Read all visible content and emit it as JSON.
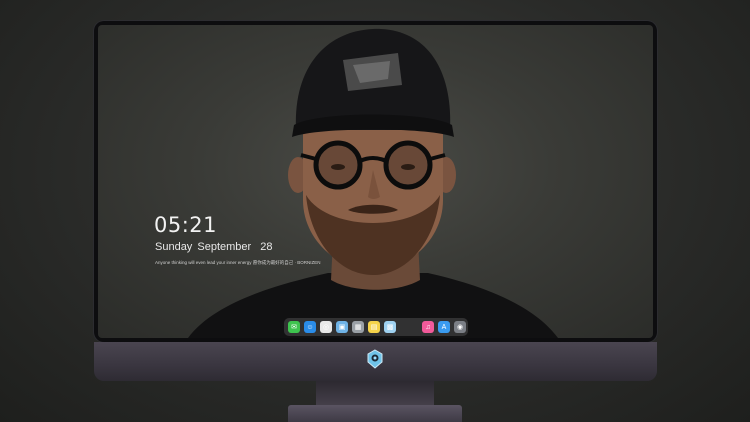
{
  "lockscreen": {
    "time": "05:21",
    "date_weekday": "Sunday",
    "date_month": "September",
    "date_day": "28",
    "quote": "Anyone thinking will even lead your inner energy 愿你成为最好的自己 · BORNIZEN"
  },
  "dock": {
    "apps": [
      {
        "name": "messages-icon",
        "color": "#3ec44f",
        "glyph": "✉"
      },
      {
        "name": "finder-icon",
        "color": "#2a8ce8",
        "glyph": "☺"
      },
      {
        "name": "safari-icon",
        "color": "#e8e8e8",
        "glyph": "◎"
      },
      {
        "name": "preview-icon",
        "color": "#6fb3e6",
        "glyph": "▣"
      },
      {
        "name": "clapper-icon",
        "color": "#9aa0a6",
        "glyph": "▦"
      },
      {
        "name": "notes-icon",
        "color": "#f5d34a",
        "glyph": "▤"
      },
      {
        "name": "photos-icon",
        "color": "#9fd1f0",
        "glyph": "▩"
      },
      {
        "name": "music-icon",
        "color": "#f25a9a",
        "glyph": "♫"
      },
      {
        "name": "appstore-icon",
        "color": "#3a9bf0",
        "glyph": "A"
      },
      {
        "name": "camera-icon",
        "color": "#7b7f86",
        "glyph": "◉"
      }
    ]
  },
  "colors": {
    "background": "#2a2b29",
    "bezel": "#0d0d0f",
    "chin": "#3a3640",
    "dock": "#3c3c3e"
  }
}
